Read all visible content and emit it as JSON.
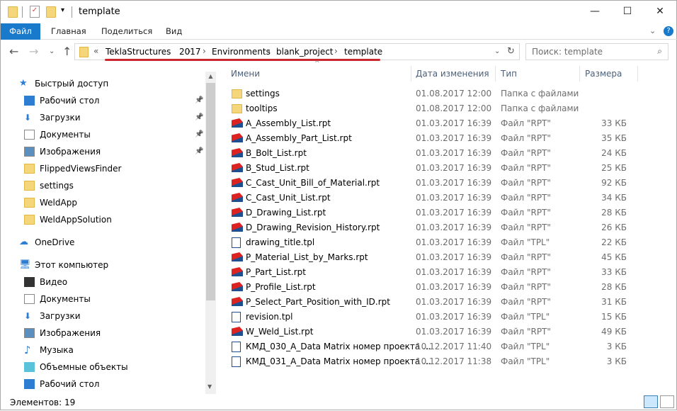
{
  "window": {
    "title": "template"
  },
  "ribbon": {
    "tabs": [
      "Файл",
      "Главная",
      "Поделиться",
      "Вид"
    ]
  },
  "address": {
    "prefix": "«",
    "crumbs": [
      "TeklaStructures",
      "2017",
      "Environments",
      "blank_project",
      "template"
    ]
  },
  "search": {
    "placeholder": "Поиск: template"
  },
  "sidebar": {
    "quick_access": "Быстрый доступ",
    "quick_items": [
      {
        "label": "Рабочий стол",
        "icon": "desktop-icon",
        "pinned": true
      },
      {
        "label": "Загрузки",
        "icon": "download-icon",
        "pinned": true
      },
      {
        "label": "Документы",
        "icon": "documents-icon",
        "pinned": true
      },
      {
        "label": "Изображения",
        "icon": "pictures-icon",
        "pinned": true
      },
      {
        "label": "FlippedViewsFinder",
        "icon": "folder-icon",
        "pinned": false
      },
      {
        "label": "settings",
        "icon": "folder-icon",
        "pinned": false
      },
      {
        "label": "WeldApp",
        "icon": "folder-icon",
        "pinned": false
      },
      {
        "label": "WeldAppSolution",
        "icon": "folder-icon",
        "pinned": false
      }
    ],
    "onedrive": "OneDrive",
    "this_pc": "Этот компьютер",
    "pc_items": [
      {
        "label": "Видео",
        "icon": "video-icon"
      },
      {
        "label": "Документы",
        "icon": "documents-icon"
      },
      {
        "label": "Загрузки",
        "icon": "download-icon"
      },
      {
        "label": "Изображения",
        "icon": "pictures-icon"
      },
      {
        "label": "Музыка",
        "icon": "music-icon"
      },
      {
        "label": "Объемные объекты",
        "icon": "3d-objects-icon"
      },
      {
        "label": "Рабочий стол",
        "icon": "desktop-icon"
      }
    ]
  },
  "columns": {
    "name": "Имени",
    "date": "Дата изменения",
    "type": "Тип",
    "size": "Размера"
  },
  "files": [
    {
      "name": "settings",
      "date": "01.08.2017 12:00",
      "type": "Папка с файлами",
      "size": "",
      "kind": "folder"
    },
    {
      "name": "tooltips",
      "date": "01.08.2017 12:00",
      "type": "Папка с файлами",
      "size": "",
      "kind": "folder"
    },
    {
      "name": "A_Assembly_List.rpt",
      "date": "01.03.2017 16:39",
      "type": "Файл \"RPT\"",
      "size": "33 КБ",
      "kind": "rpt"
    },
    {
      "name": "A_Assembly_Part_List.rpt",
      "date": "01.03.2017 16:39",
      "type": "Файл \"RPT\"",
      "size": "35 КБ",
      "kind": "rpt"
    },
    {
      "name": "B_Bolt_List.rpt",
      "date": "01.03.2017 16:39",
      "type": "Файл \"RPT\"",
      "size": "24 КБ",
      "kind": "rpt"
    },
    {
      "name": "B_Stud_List.rpt",
      "date": "01.03.2017 16:39",
      "type": "Файл \"RPT\"",
      "size": "25 КБ",
      "kind": "rpt"
    },
    {
      "name": "C_Cast_Unit_Bill_of_Material.rpt",
      "date": "01.03.2017 16:39",
      "type": "Файл \"RPT\"",
      "size": "92 КБ",
      "kind": "rpt"
    },
    {
      "name": "C_Cast_Unit_List.rpt",
      "date": "01.03.2017 16:39",
      "type": "Файл \"RPT\"",
      "size": "34 КБ",
      "kind": "rpt"
    },
    {
      "name": "D_Drawing_List.rpt",
      "date": "01.03.2017 16:39",
      "type": "Файл \"RPT\"",
      "size": "28 КБ",
      "kind": "rpt"
    },
    {
      "name": "D_Drawing_Revision_History.rpt",
      "date": "01.03.2017 16:39",
      "type": "Файл \"RPT\"",
      "size": "26 КБ",
      "kind": "rpt"
    },
    {
      "name": "drawing_title.tpl",
      "date": "01.03.2017 16:39",
      "type": "Файл \"TPL\"",
      "size": "22 КБ",
      "kind": "tpl"
    },
    {
      "name": "P_Material_List_by_Marks.rpt",
      "date": "01.03.2017 16:39",
      "type": "Файл \"RPT\"",
      "size": "45 КБ",
      "kind": "rpt"
    },
    {
      "name": "P_Part_List.rpt",
      "date": "01.03.2017 16:39",
      "type": "Файл \"RPT\"",
      "size": "33 КБ",
      "kind": "rpt"
    },
    {
      "name": "P_Profile_List.rpt",
      "date": "01.03.2017 16:39",
      "type": "Файл \"RPT\"",
      "size": "28 КБ",
      "kind": "rpt"
    },
    {
      "name": "P_Select_Part_Position_with_ID.rpt",
      "date": "01.03.2017 16:39",
      "type": "Файл \"RPT\"",
      "size": "31 КБ",
      "kind": "rpt"
    },
    {
      "name": "revision.tpl",
      "date": "01.03.2017 16:39",
      "type": "Файл \"TPL\"",
      "size": "15 КБ",
      "kind": "tpl"
    },
    {
      "name": "W_Weld_List.rpt",
      "date": "01.03.2017 16:39",
      "type": "Файл \"RPT\"",
      "size": "49 КБ",
      "kind": "rpt"
    },
    {
      "name": "КМД_030_A_Data Matrix номер проекта ...",
      "date": "10.12.2017 11:40",
      "type": "Файл \"TPL\"",
      "size": "3 КБ",
      "kind": "tpl"
    },
    {
      "name": "КМД_031_A_Data Matrix номер проекта ...",
      "date": "10.12.2017 11:38",
      "type": "Файл \"TPL\"",
      "size": "3 КБ",
      "kind": "tpl"
    }
  ],
  "status": {
    "count": "Элементов: 19"
  },
  "colors": {
    "accent": "#1979ca",
    "underline": "#c8282e"
  }
}
